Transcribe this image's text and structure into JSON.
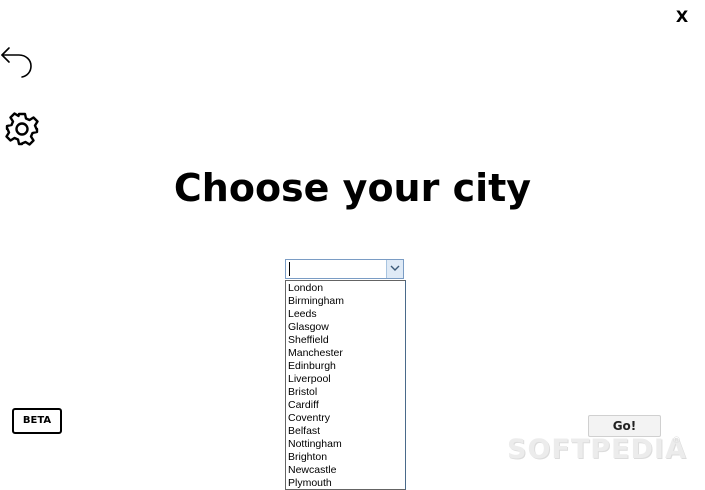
{
  "window": {
    "close_label": "X"
  },
  "icons": {
    "back": "back-arrow-icon",
    "settings": "gear-icon",
    "dropdown": "chevron-down-icon"
  },
  "main": {
    "title": "Choose your city"
  },
  "city_select": {
    "value": "",
    "options": [
      "London",
      "Birmingham",
      "Leeds",
      "Glasgow",
      "Sheffield",
      "Manchester",
      "Edinburgh",
      "Liverpool",
      "Bristol",
      "Cardiff",
      "Coventry",
      "Belfast",
      "Nottingham",
      "Brighton",
      "Newcastle",
      "Plymouth"
    ]
  },
  "badge": {
    "label": "BETA"
  },
  "actions": {
    "go_label": "Go!"
  },
  "watermark": {
    "text": "SOFTPEDIA",
    "mark": "®"
  },
  "colors": {
    "background": "#ffffff",
    "text": "#000000",
    "combo_border": "#7a9cc4",
    "combo_arrow_bg": "#dfeaf6",
    "go_button_bg": "#f3f3f3"
  }
}
